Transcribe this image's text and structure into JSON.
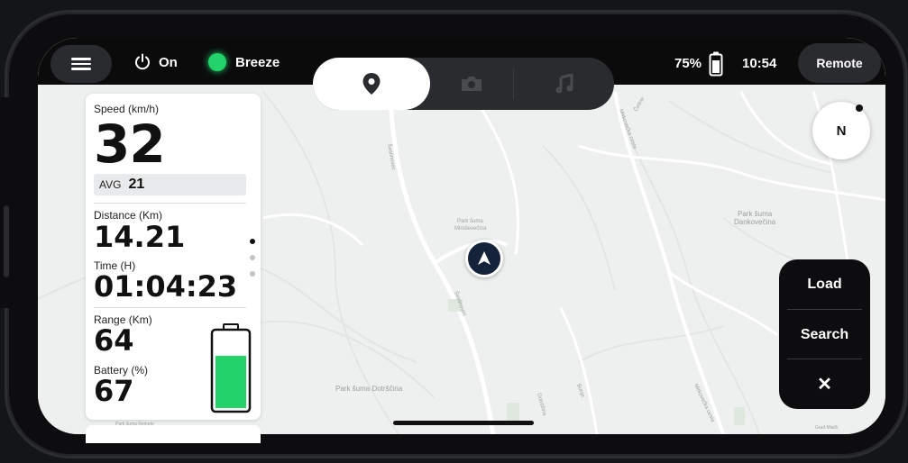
{
  "status_bar": {
    "power_label": "On",
    "mode_label": "Breeze",
    "battery_percent": "75%",
    "battery_level": 0.75,
    "time": "10:54",
    "remote_label": "Remote"
  },
  "tabs": [
    {
      "name": "map",
      "icon": "map-pin-icon",
      "active": true
    },
    {
      "name": "camera",
      "icon": "camera-icon",
      "active": false
    },
    {
      "name": "music",
      "icon": "music-note-icon",
      "active": false
    }
  ],
  "stats": {
    "speed_label": "Speed (km/h)",
    "speed_value": "32",
    "avg_label": "AVG",
    "avg_value": "21",
    "distance_label": "Distance (Km)",
    "distance_value": "14.21",
    "time_label": "Time (H)",
    "time_value": "01:04:23",
    "range_label": "Range (Km)",
    "range_value": "64",
    "battery_label": "Battery (%)",
    "battery_value": "67",
    "battery_level": 0.67
  },
  "pager": {
    "count": 3,
    "active_index": 0
  },
  "compass": {
    "label": "N"
  },
  "actions": {
    "load": "Load",
    "search": "Search",
    "close": "✕"
  },
  "map_labels": {
    "park1": "Park šuma",
    "park1b": "Miroševečina",
    "park2": "Park šuma",
    "park2b": "Dankovečina",
    "park3": "Park šuma Dotrščina",
    "park4": "Park šuma Remete",
    "road1": "Šestinovec",
    "road2": "Šestinovec",
    "road3": "Mirkovečka cesta",
    "road4": "Mirkovečka cesta",
    "road5": "Bunje",
    "road6": "Čeline",
    "road7": "Grad Miačk",
    "road8": "Dotrščina"
  },
  "colors": {
    "accent_green": "#22d36a",
    "dark": "#0d0d0f",
    "panel": "#ffffff"
  }
}
